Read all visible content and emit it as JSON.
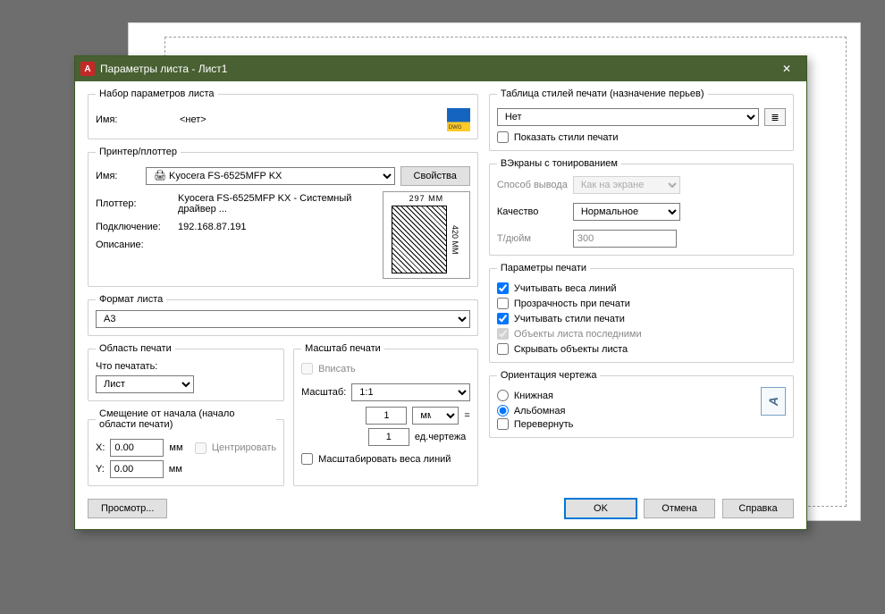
{
  "title": "Параметры листа - Лист1",
  "paramset": {
    "legend": "Набор параметров листа",
    "name_label": "Имя:",
    "name_value": "<нет>"
  },
  "printer": {
    "legend": "Принтер/плоттер",
    "name_label": "Имя:",
    "name_value": "Kyocera FS-6525MFP KX",
    "props_btn": "Свойства",
    "plotter_label": "Плоттер:",
    "plotter_value": "Kyocera FS-6525MFP KX - Системный драйвер ...",
    "conn_label": "Подключение:",
    "conn_value": "192.168.87.191",
    "desc_label": "Описание:",
    "dim_w": "297 MM",
    "dim_h": "420 MM"
  },
  "paper": {
    "legend": "Формат листа",
    "value": "A3"
  },
  "area": {
    "legend": "Область печати",
    "what_label": "Что печатать:",
    "what_value": "Лист"
  },
  "offset": {
    "legend": "Смещение от начала (начало области печати)",
    "x_label": "X:",
    "x_value": "0.00",
    "y_label": "Y:",
    "y_value": "0.00",
    "unit": "мм",
    "center": "Центрировать"
  },
  "scale": {
    "legend": "Масштаб печати",
    "fit": "Вписать",
    "scale_label": "Масштаб:",
    "scale_value": "1:1",
    "num_value": "1",
    "unit_value": "мм",
    "eq": "=",
    "den_value": "1",
    "den_unit": "ед.чертежа",
    "scale_lw": "Масштабировать веса линий"
  },
  "styletable": {
    "legend": "Таблица стилей печати (назначение перьев)",
    "value": "Нет",
    "show_styles": "Показать стили печати"
  },
  "shaded": {
    "legend": "ВЭкраны с тонированием",
    "method_label": "Способ вывода",
    "method_value": "Как на экране",
    "quality_label": "Качество",
    "quality_value": "Нормальное",
    "dpi_label": "Т/дюйм",
    "dpi_value": "300"
  },
  "options": {
    "legend": "Параметры печати",
    "lw": "Учитывать веса линий",
    "transp": "Прозрачность при печати",
    "styles": "Учитывать стили печати",
    "last": "Объекты листа последними",
    "hide": "Скрывать объекты листа"
  },
  "orient": {
    "legend": "Ориентация чертежа",
    "portrait": "Книжная",
    "landscape": "Альбомная",
    "flip": "Перевернуть"
  },
  "footer": {
    "preview": "Просмотр...",
    "ok": "OK",
    "cancel": "Отмена",
    "help": "Справка"
  }
}
